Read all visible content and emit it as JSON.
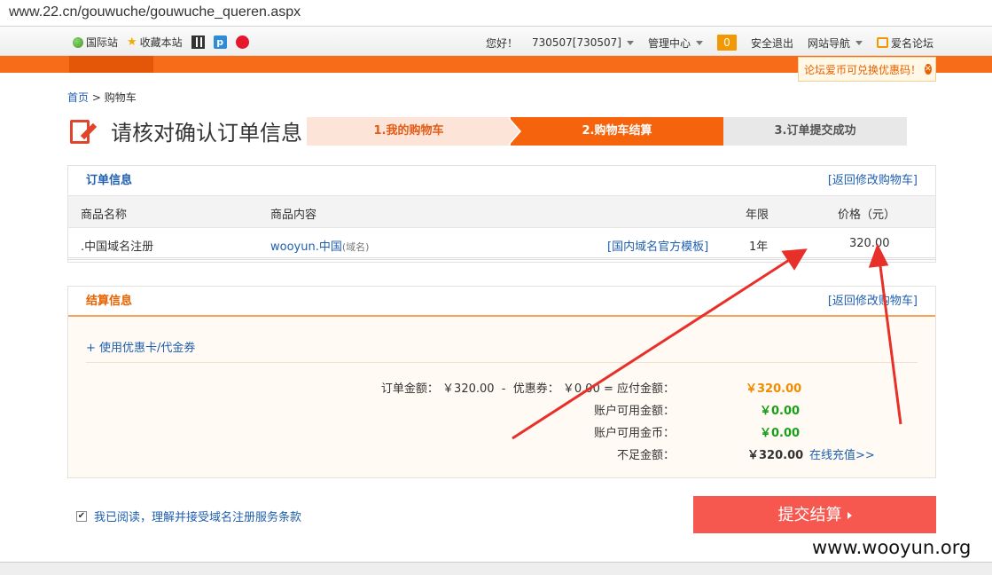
{
  "browser": {
    "url": "www.22.cn/gouwuche/gouwuche_queren.aspx"
  },
  "topbar": {
    "intl": "国际站",
    "favorite": "收藏本站",
    "greeting": "您好！",
    "user": "730507[730507]",
    "manage": "管理中心",
    "badge": "0",
    "logout": "安全退出",
    "sitenav": "网站导航",
    "forum": "爱名论坛"
  },
  "tooltip": {
    "text": "论坛爱币可兑换优惠码！"
  },
  "breadcrumb": {
    "home": "首页",
    "sep": ">",
    "current": "购物车"
  },
  "page": {
    "title": "请核对确认订单信息"
  },
  "steps": [
    {
      "label": "1.我的购物车"
    },
    {
      "label": "2.购物车结算"
    },
    {
      "label": "3.订单提交成功"
    }
  ],
  "order": {
    "title": "订单信息",
    "back_link": "[返回修改购物车]",
    "columns": {
      "name": "商品名称",
      "content": "商品内容",
      "period": "年限",
      "price": "价格（元）"
    },
    "row": {
      "name": ".中国域名注册",
      "domain": "wooyun.中国",
      "domain_type": "(域名)",
      "template": "[国内域名官方模板]",
      "period": "1年",
      "price": "320.00"
    }
  },
  "settle": {
    "title": "结算信息",
    "back_link": "[返回修改购物车]",
    "coupon": "+ 使用优惠卡/代金券",
    "summary": "订单金额： ￥320.00  -  优惠券： ￥0.00 = 应付金额：",
    "payable": "￥320.00",
    "balance_label": "账户可用金额：",
    "balance": "￥0.00",
    "coin_label": "账户可用金币：",
    "coin": "￥0.00",
    "short_label": "不足金额：",
    "short": "￥320.00",
    "recharge": "在线充值>>"
  },
  "agree": {
    "text": "我已阅读，理解并接受域名注册服务条款"
  },
  "submit": {
    "label": "提交结算"
  },
  "watermark": "www.wooyun.org",
  "colors": {
    "accent": "#f5640d",
    "annotation": "#e8302a",
    "link": "#1f5fae"
  }
}
